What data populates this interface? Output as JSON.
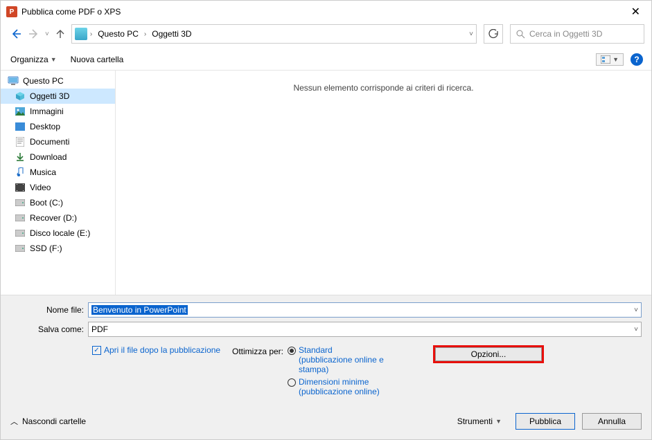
{
  "titlebar": {
    "title": "Pubblica come PDF o XPS"
  },
  "nav": {
    "breadcrumb": [
      "Questo PC",
      "Oggetti 3D"
    ],
    "search_placeholder": "Cerca in Oggetti 3D"
  },
  "toolbar": {
    "organize": "Organizza",
    "new_folder": "Nuova cartella"
  },
  "tree": {
    "root": "Questo PC",
    "items": [
      {
        "label": "Oggetti 3D",
        "icon": "cube",
        "selected": true
      },
      {
        "label": "Immagini",
        "icon": "pictures"
      },
      {
        "label": "Desktop",
        "icon": "desktop"
      },
      {
        "label": "Documenti",
        "icon": "docs"
      },
      {
        "label": "Download",
        "icon": "download"
      },
      {
        "label": "Musica",
        "icon": "music"
      },
      {
        "label": "Video",
        "icon": "video"
      },
      {
        "label": "Boot (C:)",
        "icon": "drive"
      },
      {
        "label": "Recover (D:)",
        "icon": "drive"
      },
      {
        "label": "Disco locale (E:)",
        "icon": "drive"
      },
      {
        "label": "SSD (F:)",
        "icon": "drive"
      }
    ]
  },
  "content": {
    "empty_message": "Nessun elemento corrisponde ai criteri di ricerca."
  },
  "fields": {
    "filename_label": "Nome file:",
    "filename_value": "Benvenuto in PowerPoint",
    "saveas_label": "Salva come:",
    "saveas_value": "PDF"
  },
  "options": {
    "open_after_label": "Apri il file dopo la pubblicazione",
    "optimize_label": "Ottimizza per:",
    "standard_l1": "Standard",
    "standard_l2": "(pubblicazione online e stampa)",
    "min_l1": "Dimensioni minime",
    "min_l2": "(pubblicazione online)",
    "options_btn": "Opzioni..."
  },
  "footer": {
    "hide_folders": "Nascondi cartelle",
    "tools": "Strumenti",
    "publish": "Pubblica",
    "cancel": "Annulla"
  }
}
